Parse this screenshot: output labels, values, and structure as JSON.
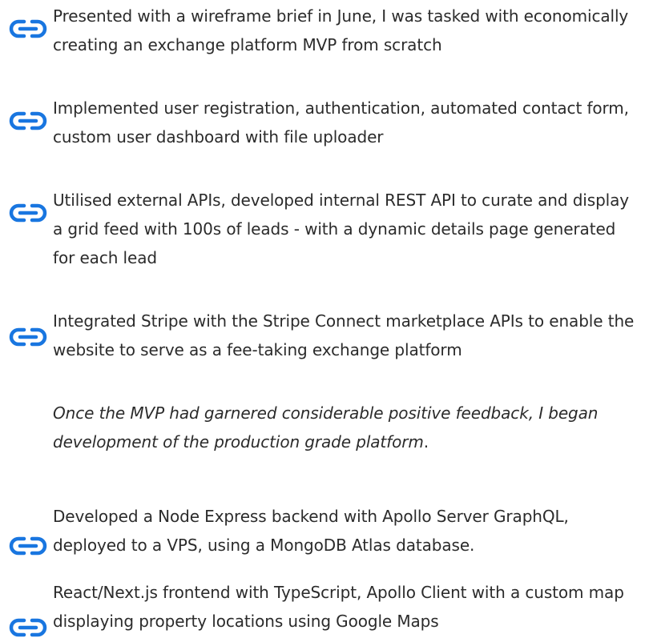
{
  "colors": {
    "text": "#2b2b2b",
    "icon": "#1976e0"
  },
  "icon_name": "link-icon",
  "items": [
    {
      "text": "Presented with a wireframe brief in June, I was tasked with economically creating an exchange platform MVP from scratch"
    },
    {
      "text": "Implemented user registration, authentication, automated contact form, custom user dashboard with file uploader"
    },
    {
      "text": "Utilised external APIs, developed internal REST API to curate and display a grid feed with 100s of leads - with a dynamic details page generated for each lead"
    },
    {
      "text": "Integrated Stripe with the Stripe Connect marketplace APIs to enable the website to serve as a fee-taking exchange platform"
    },
    {
      "text": "Developed a Node Express backend with Apollo Server GraphQL, deployed to a VPS, using a MongoDB Atlas database."
    },
    {
      "text": "React/Next.js frontend with TypeScript, Apollo Client with a custom map displaying property locations using Google Maps"
    }
  ],
  "note": {
    "text": "Once the MVP had garnered considerable positive feedback, I began development of the production grade platform",
    "trailing": "."
  }
}
